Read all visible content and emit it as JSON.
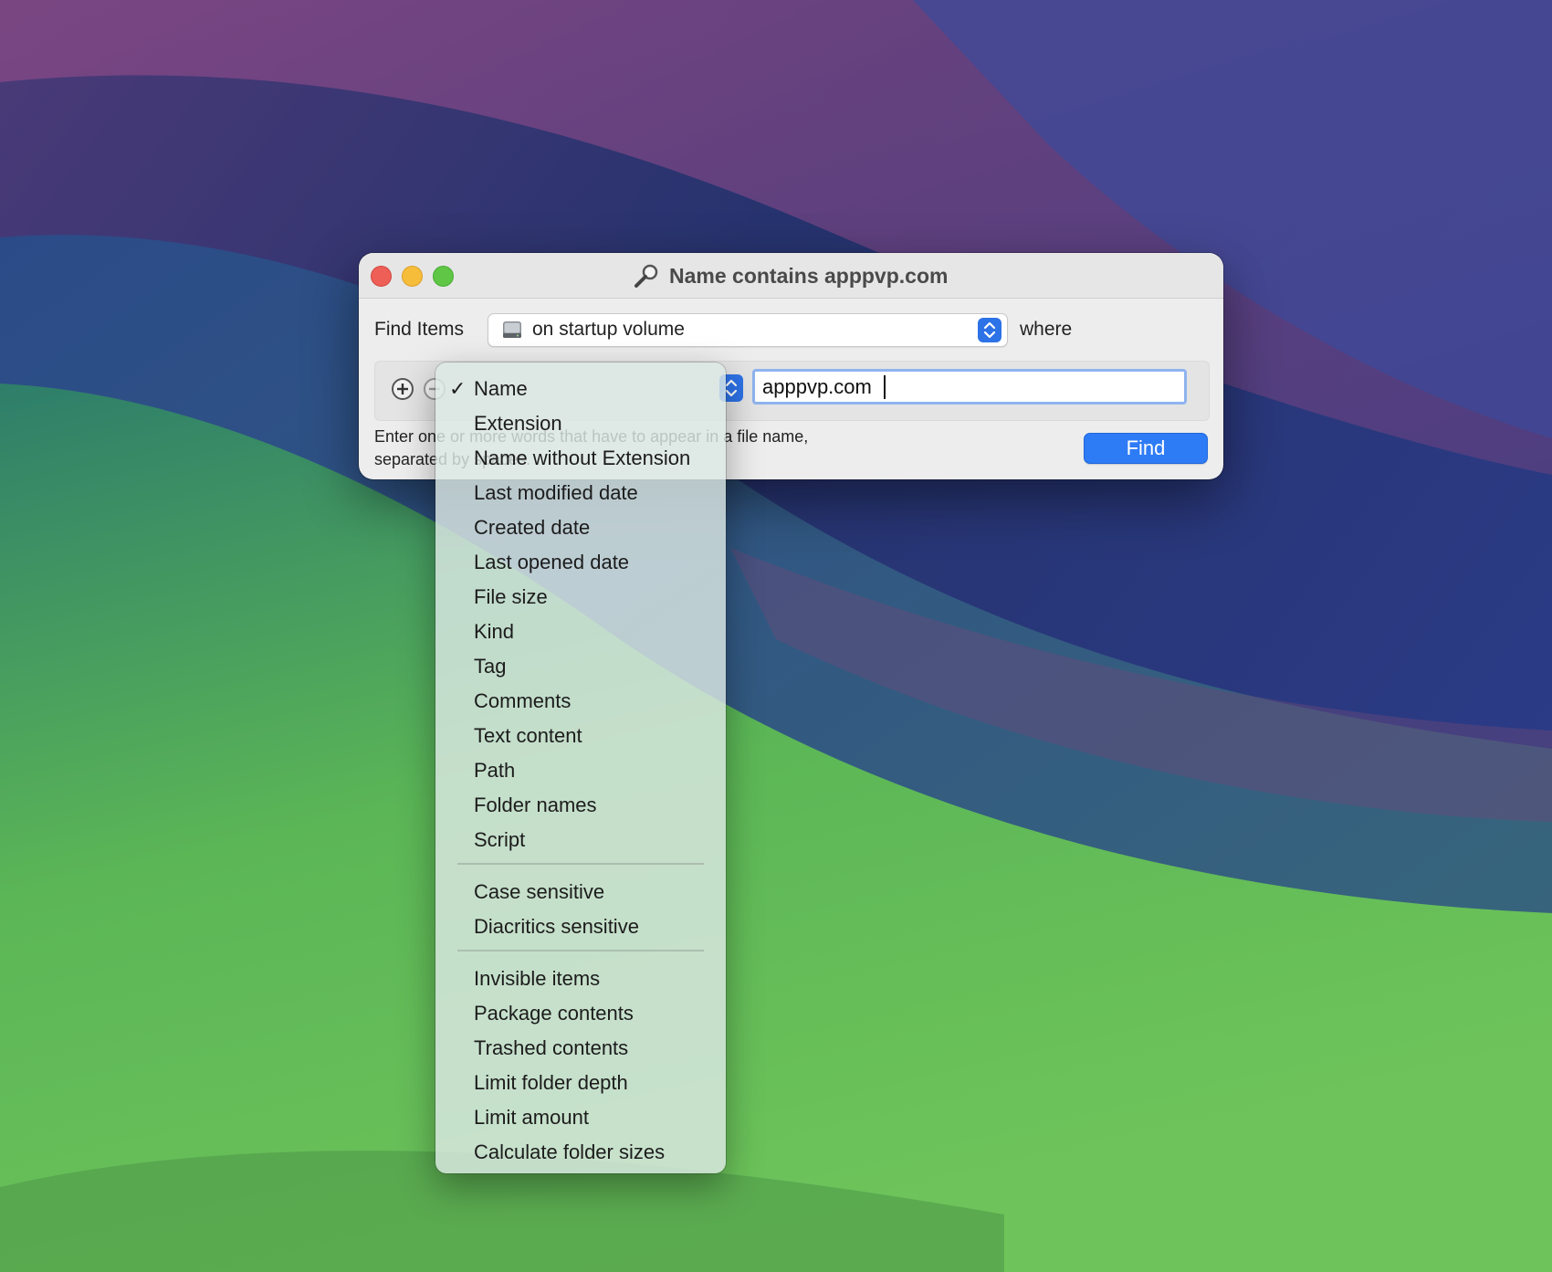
{
  "window": {
    "title": "Name contains apppvp.com"
  },
  "search": {
    "find_items_label": "Find Items",
    "volume_value": "on startup volume",
    "where_label": "where",
    "value": "apppvp.com",
    "help_text_line1": "Enter one or more words that have to appear in a file name,",
    "help_text_line2": "separated by spaces.",
    "find_button": "Find"
  },
  "menu": {
    "selected": "Name",
    "items": [
      "Name",
      "Extension",
      "Name without Extension",
      "Last modified date",
      "Created date",
      "Last opened date",
      "File size",
      "Kind",
      "Tag",
      "Comments",
      "Text content",
      "Path",
      "Folder names",
      "Script"
    ],
    "options": [
      "Case sensitive",
      "Diacritics sensitive"
    ],
    "scope": [
      "Invisible items",
      "Package contents",
      "Trashed contents",
      "Limit folder depth",
      "Limit amount",
      "Calculate folder sizes"
    ]
  },
  "colors": {
    "accent": "#2e7bf6",
    "close": "#ee5f57",
    "minimize": "#f6bd3b",
    "maximize": "#5fc646"
  }
}
